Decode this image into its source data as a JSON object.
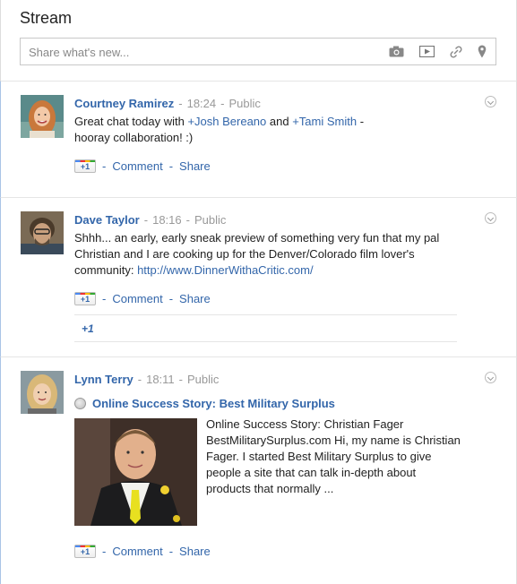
{
  "stream": {
    "title": "Stream",
    "share_placeholder": "Share what's new...",
    "share_icons": [
      "camera-icon",
      "video-icon",
      "link-icon",
      "location-pin-icon"
    ]
  },
  "posts": [
    {
      "author": "Courtney Ramirez",
      "time": "18:24",
      "visibility": "Public",
      "body_pre": "Great chat today with ",
      "mention1": "+Josh Bereano",
      "body_mid": " and ",
      "mention2": "+Tami Smith",
      "body_post": " - hooray collaboration! :)",
      "actions": {
        "plus1": "+1",
        "comment": "Comment",
        "share": "Share"
      }
    },
    {
      "author": "Dave Taylor",
      "time": "18:16",
      "visibility": "Public",
      "body": "Shhh... an early, early sneak preview of something very fun that my pal Christian and I are cooking up for the Denver/Colorado film lover's community: ",
      "link": "http://www.DinnerWithaCritic.com/",
      "actions": {
        "plus1": "+1",
        "comment": "Comment",
        "share": "Share"
      },
      "plus_box": "+1"
    },
    {
      "author": "Lynn Terry",
      "time": "18:11",
      "visibility": "Public",
      "attachment_title": "Online Success Story: Best Military Surplus",
      "attachment_text": "Online Success Story: Christian Fager BestMilitarySurplus.com Hi, my name is Christian Fager. I started Best Military Surplus to give people a site that can talk in-depth about products that normally ...",
      "actions": {
        "plus1": "+1",
        "comment": "Comment",
        "share": "Share"
      }
    }
  ],
  "separator": "-",
  "colors": {
    "link": "#3366aa",
    "meta": "#999999",
    "post_border": "#aac4e6"
  }
}
